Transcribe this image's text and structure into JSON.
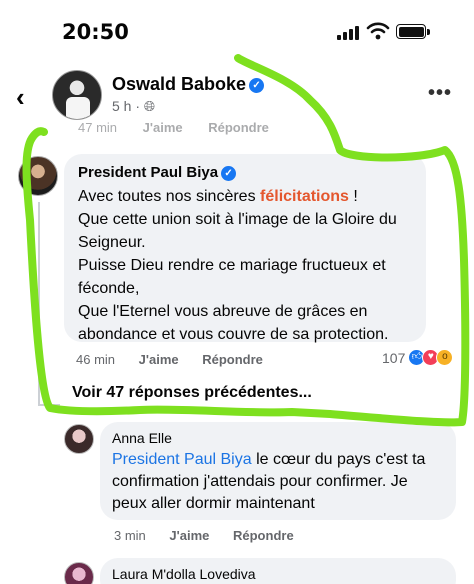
{
  "status_bar": {
    "time": "20:50"
  },
  "header": {
    "name": "Oswald Baboke",
    "meta": "5 h · ",
    "back_icon": "chevron-left-icon",
    "more_icon": "more-horizontal-icon"
  },
  "faded_row": {
    "time": "47 min",
    "like": "J'aime",
    "reply": "Répondre"
  },
  "main_comment": {
    "author": "President Paul Biya",
    "line1_pre": "Avec toutes nos sincères ",
    "line1_accent": "félicitations",
    "line1_post": " !",
    "rest": "Que cette union soit à l'image de la Gloire du Seigneur.\nPuisse Dieu rendre ce mariage fructueux et féconde,\nQue l'Eternel vous abreuve de grâces en abondance et vous couvre de sa protection.",
    "time": "46 min",
    "like": "J'aime",
    "reply": "Répondre",
    "reaction_count": "107",
    "accent_color": "#e4572e"
  },
  "view_replies": "Voir 47 réponses précédentes...",
  "reply_anna": {
    "author": "Anna Elle",
    "mention": "President Paul Biya",
    "text": " le cœur du pays c'est ta confirmation j'attendais pour confirmer. Je peux aller dormir maintenant",
    "time": "3 min",
    "like": "J'aime",
    "reply": "Répondre"
  },
  "reply_laura": {
    "author": "Laura M'dolla Lovediva"
  },
  "colors": {
    "highlight": "#7ee01f",
    "link": "#1b74e4",
    "verified": "#1877f2"
  }
}
